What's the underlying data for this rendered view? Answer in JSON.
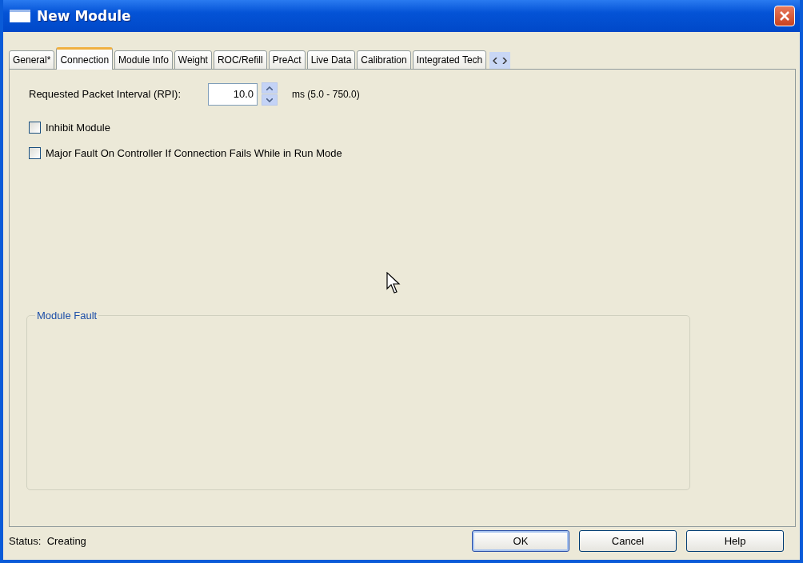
{
  "window": {
    "title": "New Module"
  },
  "tabs": [
    {
      "label": "General*",
      "selected": false
    },
    {
      "label": "Connection",
      "selected": true
    },
    {
      "label": "Module Info",
      "selected": false
    },
    {
      "label": "Weight",
      "selected": false
    },
    {
      "label": "ROC/Refill",
      "selected": false
    },
    {
      "label": "PreAct",
      "selected": false
    },
    {
      "label": "Live Data",
      "selected": false
    },
    {
      "label": "Calibration",
      "selected": false
    },
    {
      "label": "Integrated Tech",
      "selected": false
    }
  ],
  "rpi": {
    "label": "Requested Packet Interval (RPI):",
    "value": "10.0",
    "range": "ms (5.0 - 750.0)"
  },
  "options": [
    {
      "label": "Inhibit Module",
      "checked": false
    },
    {
      "label": "Major Fault On Controller If Connection Fails While in Run Mode",
      "checked": false
    }
  ],
  "module_fault": {
    "title": "Module Fault"
  },
  "status": {
    "label": "Status:",
    "value": "Creating"
  },
  "buttons": [
    {
      "label": "OK",
      "default": true
    },
    {
      "label": "Cancel",
      "default": false
    },
    {
      "label": "Help",
      "default": false
    }
  ]
}
